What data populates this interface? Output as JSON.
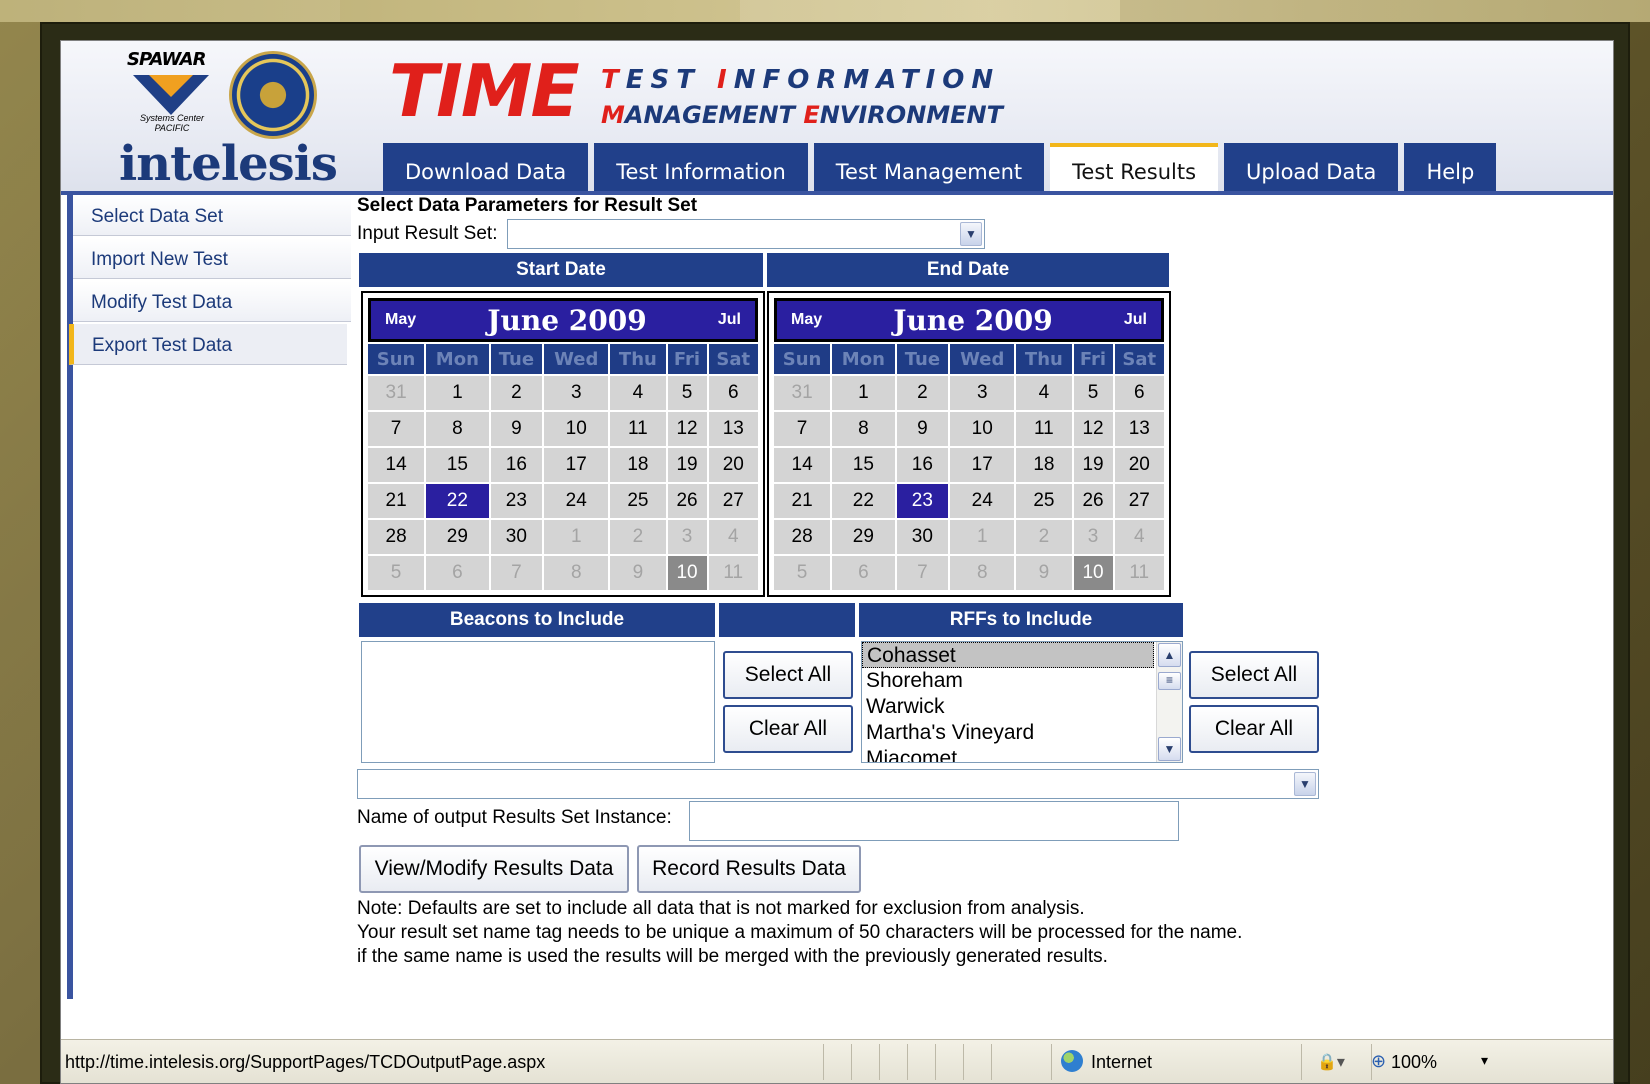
{
  "header": {
    "spawar": "SPAWAR",
    "spawar_sub": "Systems Center PACIFIC",
    "intelesis": "intelesis",
    "time": "TIME",
    "line1_a": "T",
    "line1_b": "EST ",
    "line1_c": "I",
    "line1_d": "NFORMATION",
    "line2_a": "M",
    "line2_b": "ANAGEMENT ",
    "line2_c": "E",
    "line2_d": "NVIRONMENT"
  },
  "tabs": [
    {
      "label": "Download Data"
    },
    {
      "label": "Test Information"
    },
    {
      "label": "Test Management"
    },
    {
      "label": "Test Results"
    },
    {
      "label": "Upload Data"
    },
    {
      "label": "Help"
    }
  ],
  "sidebar": {
    "items": [
      {
        "label": "Select Data Set"
      },
      {
        "label": "Import New Test"
      },
      {
        "label": "Modify Test Data"
      },
      {
        "label": "Export Test Data"
      }
    ]
  },
  "main": {
    "title": "Select Data Parameters for Result Set",
    "input_label": "Input Result Set:",
    "start_header": "Start Date",
    "end_header": "End Date",
    "beacons_header": "Beacons to Include",
    "rffs_header": "RFFs to Include",
    "select_all": "Select All",
    "clear_all": "Clear All",
    "name_label": "Name of output Results Set Instance:",
    "view_button": "View/Modify Results Data",
    "record_button": "Record Results Data",
    "note1": "Note: Defaults are set to include all data that is not marked for exclusion from analysis.",
    "note2": "Your result set name tag needs to be unique a maximum of 50 characters will be processed for the name.",
    "note3": "if the same name is used the results will be merged with the previously generated results."
  },
  "calendar": {
    "prev": "May",
    "month": "June 2009",
    "next": "Jul",
    "dow": [
      "Sun",
      "Mon",
      "Tue",
      "Wed",
      "Thu",
      "Fri",
      "Sat"
    ],
    "weeks": [
      [
        "31",
        "1",
        "2",
        "3",
        "4",
        "5",
        "6"
      ],
      [
        "7",
        "8",
        "9",
        "10",
        "11",
        "12",
        "13"
      ],
      [
        "14",
        "15",
        "16",
        "17",
        "18",
        "19",
        "20"
      ],
      [
        "21",
        "22",
        "23",
        "24",
        "25",
        "26",
        "27"
      ],
      [
        "28",
        "29",
        "30",
        "1",
        "2",
        "3",
        "4"
      ],
      [
        "5",
        "6",
        "7",
        "8",
        "9",
        "10",
        "11"
      ]
    ],
    "start_selected": "22",
    "end_selected": "23",
    "today": "10"
  },
  "rffs": [
    "Cohasset",
    "Shoreham",
    "Warwick",
    "Martha's Vineyard",
    "Miacomet"
  ],
  "statusbar": {
    "url": "http://time.intelesis.org/SupportPages/TCDOutputPage.aspx",
    "zone": "Internet",
    "zoom": "100%"
  },
  "colors": {
    "nav_blue": "#21408a",
    "accent_gold": "#f2b61a",
    "brand_red": "#e0201b",
    "calendar_header": "#2a1fa0"
  }
}
